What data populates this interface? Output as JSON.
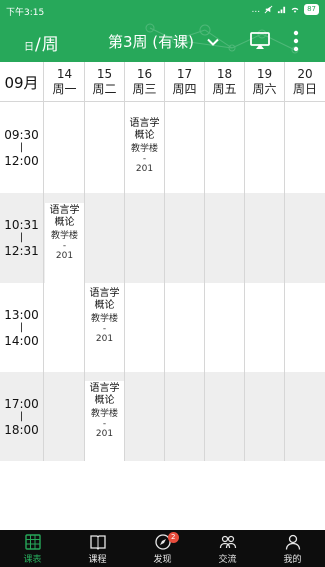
{
  "status_bar": {
    "time": "下午3:15",
    "signal": "...",
    "battery": "87"
  },
  "header": {
    "view_day": "日",
    "view_sep": "/",
    "view_week": "周",
    "week_title": "第3周 (有课)"
  },
  "calendar": {
    "month": "09月",
    "days": [
      {
        "date": "14",
        "weekday": "周一"
      },
      {
        "date": "15",
        "weekday": "周二"
      },
      {
        "date": "16",
        "weekday": "周三"
      },
      {
        "date": "17",
        "weekday": "周四"
      },
      {
        "date": "18",
        "weekday": "周五"
      },
      {
        "date": "19",
        "weekday": "周六"
      },
      {
        "date": "20",
        "weekday": "周日"
      }
    ],
    "slots": [
      {
        "start": "09:30",
        "bar": "|",
        "end": "12:00"
      },
      {
        "start": "10:31",
        "bar": "|",
        "end": "12:31"
      },
      {
        "start": "13:00",
        "bar": "|",
        "end": "14:00"
      },
      {
        "start": "17:00",
        "bar": "|",
        "end": "18:00"
      }
    ],
    "courses": [
      {
        "name": "语言学概论",
        "building": "教学楼",
        "dash": "-",
        "room": "201"
      },
      {
        "name": "语言学概论",
        "building": "教学楼",
        "dash": "-",
        "room": "201"
      },
      {
        "name": "语言学概论",
        "building": "教学楼",
        "dash": "-",
        "room": "201"
      },
      {
        "name": "语言学概论",
        "building": "教学楼",
        "dash": "-",
        "room": "201"
      }
    ]
  },
  "bottom_nav": {
    "items": [
      {
        "label": "课表",
        "icon": "calendar-grid-icon"
      },
      {
        "label": "课程",
        "icon": "book-icon"
      },
      {
        "label": "发现",
        "icon": "compass-icon",
        "badge": "2"
      },
      {
        "label": "交流",
        "icon": "people-icon"
      },
      {
        "label": "我的",
        "icon": "person-icon"
      }
    ]
  },
  "colors": {
    "accent": "#27a85a",
    "nav_bg": "#0d0d0d",
    "alt_row": "#eeeeee",
    "badge": "#e74c3c"
  }
}
